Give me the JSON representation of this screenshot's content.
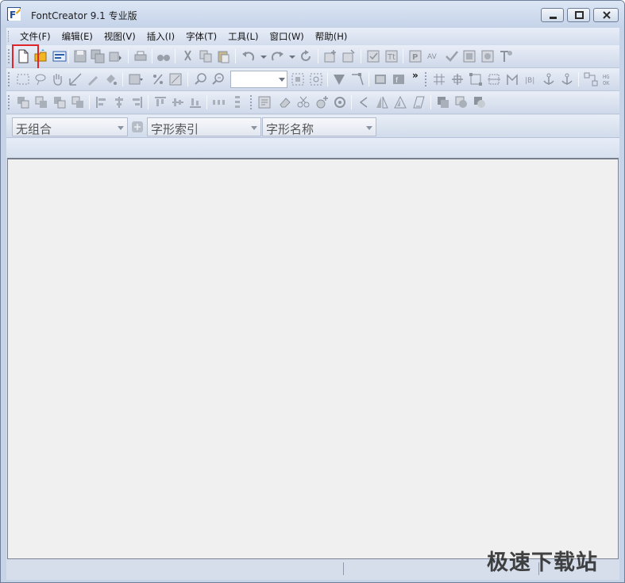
{
  "window": {
    "title": "FontCreator 9.1 专业版"
  },
  "menubar": {
    "items": [
      {
        "label": "文件(F)"
      },
      {
        "label": "编辑(E)"
      },
      {
        "label": "视图(V)"
      },
      {
        "label": "插入(I)"
      },
      {
        "label": "字体(T)"
      },
      {
        "label": "工具(L)"
      },
      {
        "label": "窗口(W)"
      },
      {
        "label": "帮助(H)"
      }
    ]
  },
  "toolbar": {
    "more_glyph": "»"
  },
  "group_bar": {
    "group_combo": "无组合",
    "glyph_index_combo": "字形索引",
    "glyph_name_combo": "字形名称"
  },
  "colors": {
    "highlight": "#e0242a",
    "chrome": "#c7d4e8",
    "workspace": "#f0f0f0"
  },
  "watermark": {
    "text": "极速下载站"
  }
}
